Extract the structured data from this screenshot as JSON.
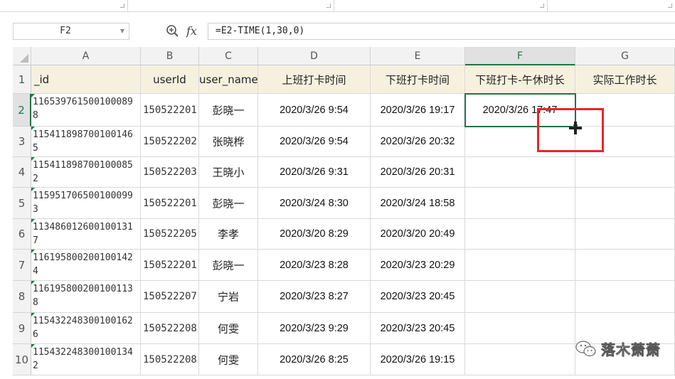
{
  "name_box": {
    "value": "F2"
  },
  "formula": {
    "value": "=E2-TIME(1,30,0)"
  },
  "columns": [
    "A",
    "B",
    "C",
    "D",
    "E",
    "F",
    "G"
  ],
  "header_row": [
    "_id",
    "userId",
    "user_name",
    "上班打卡时间",
    "下班打卡时间",
    "下班打卡-午休时长",
    "实际工作时长"
  ],
  "rows": [
    {
      "num": "1"
    },
    {
      "num": "2",
      "id_l1": "116539761500100089",
      "id_l2": "8",
      "userId": "150522201",
      "name": "彭晓一",
      "on": "2020/3/26 9:54",
      "off": "2020/3/26 19:17",
      "f": "2020/3/26 17:47",
      "g": ""
    },
    {
      "num": "3",
      "id_l1": "115411898700100146",
      "id_l2": "5",
      "userId": "150522202",
      "name": "张晓桦",
      "on": "2020/3/26 9:54",
      "off": "2020/3/26 20:32",
      "f": "",
      "g": ""
    },
    {
      "num": "4",
      "id_l1": "115411898700100085",
      "id_l2": "2",
      "userId": "150522203",
      "name": "王晓小",
      "on": "2020/3/26 9:31",
      "off": "2020/3/26 20:31",
      "f": "",
      "g": ""
    },
    {
      "num": "5",
      "id_l1": "115951706500100099",
      "id_l2": "3",
      "userId": "150522201",
      "name": "彭晓一",
      "on": "2020/3/24 8:30",
      "off": "2020/3/24 18:58",
      "f": "",
      "g": ""
    },
    {
      "num": "6",
      "id_l1": "113486012600100131",
      "id_l2": "7",
      "userId": "150522205",
      "name": "李孝",
      "on": "2020/3/20 8:29",
      "off": "2020/3/20 20:49",
      "f": "",
      "g": ""
    },
    {
      "num": "7",
      "id_l1": "116195800200100142",
      "id_l2": "4",
      "userId": "150522201",
      "name": "彭晓一",
      "on": "2020/3/23 8:28",
      "off": "2020/3/23 20:29",
      "f": "",
      "g": ""
    },
    {
      "num": "8",
      "id_l1": "116195800200100113",
      "id_l2": "8",
      "userId": "150522207",
      "name": "宁岩",
      "on": "2020/3/23 8:27",
      "off": "2020/3/23 20:45",
      "f": "",
      "g": ""
    },
    {
      "num": "9",
      "id_l1": "115432248300100162",
      "id_l2": "6",
      "userId": "150522208",
      "name": "何雯",
      "on": "2020/3/23 9:29",
      "off": "2020/3/23 20:45",
      "f": "",
      "g": ""
    },
    {
      "num": "10",
      "id_l1": "115432248300100134",
      "id_l2": "2",
      "userId": "150522208",
      "name": "何雯",
      "on": "2020/3/26 8:25",
      "off": "2020/3/26 19:15",
      "f": "",
      "g": ""
    }
  ],
  "watermark": {
    "text": "落木萧萧"
  },
  "colors": {
    "accent": "#217346",
    "header_fill": "#f6f1de",
    "highlight": "#e8262a"
  }
}
